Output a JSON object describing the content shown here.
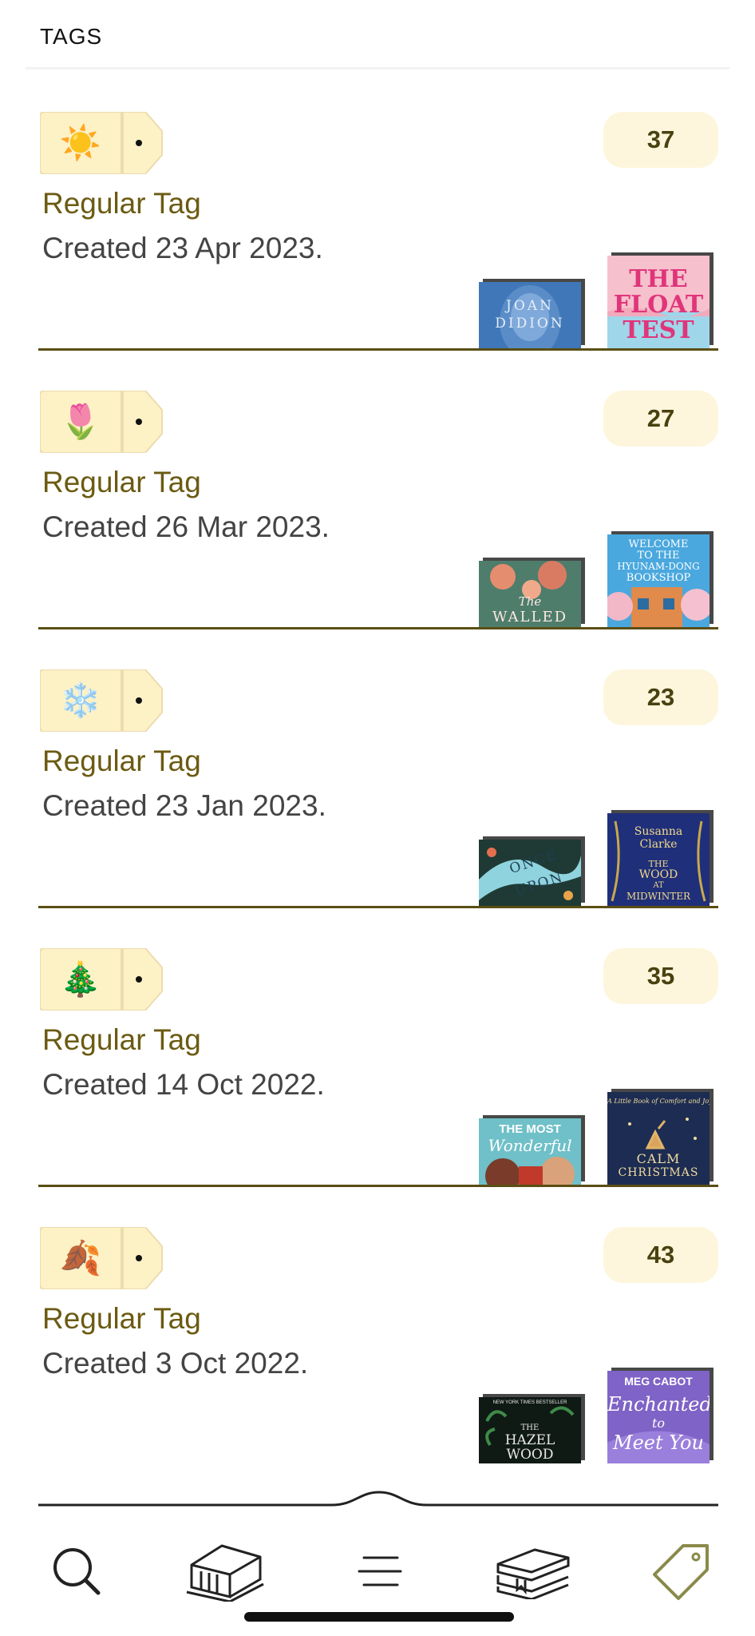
{
  "header": {
    "title": "TAGS"
  },
  "tags": [
    {
      "emoji": "☀️",
      "count": "37",
      "type": "Regular Tag",
      "created": "Created 23 Apr 2023.",
      "book_left": {
        "lines": [
          "JOAN",
          "DIDION"
        ],
        "bg": "#3f77b8",
        "fg": "#e6eef8"
      },
      "book_right": {
        "lines": [
          "THE",
          "FLOAT",
          "TEST"
        ],
        "bg": "#f6c0cc",
        "fg": "#e0357a"
      }
    },
    {
      "emoji": "🌷",
      "count": "27",
      "type": "Regular Tag",
      "created": "Created 26 Mar 2023.",
      "book_left": {
        "lines": [
          "The",
          "WALLED"
        ],
        "bg": "#5e8c7a",
        "fg": "#fbe9e0"
      },
      "book_right": {
        "lines": [
          "WELCOME",
          "TO THE",
          "HYUNAM-DONG",
          "BOOKSHOP"
        ],
        "bg": "#4aa8de",
        "fg": "#ffffff"
      }
    },
    {
      "emoji": "❄️",
      "count": "23",
      "type": "Regular Tag",
      "created": "Created 23 Jan 2023.",
      "book_left": {
        "lines": [
          "ONCE",
          "UPON"
        ],
        "bg": "#1f3a34",
        "fg": "#1e3f52"
      },
      "book_right": {
        "lines": [
          "Susanna",
          "Clarke",
          "THE",
          "WOOD",
          "AT",
          "MIDWINTER"
        ],
        "bg": "#1f2f7a",
        "fg": "#f1d98a"
      }
    },
    {
      "emoji": "🎄",
      "count": "35",
      "type": "Regular Tag",
      "created": "Created 14 Oct 2022.",
      "book_left": {
        "lines": [
          "THE MOST",
          "Wonderful"
        ],
        "bg": "#6fc0c8",
        "fg": "#ffffff"
      },
      "book_right": {
        "lines": [
          "A Little Book of Comfort and Joy",
          "CALM",
          "CHRISTMAS"
        ],
        "bg": "#1d2c52",
        "fg": "#f0dca0"
      }
    },
    {
      "emoji": "🍂",
      "count": "43",
      "type": "Regular Tag",
      "created": "Created 3 Oct 2022.",
      "book_left": {
        "lines": [
          "NEW YORK TIMES BESTSELLER",
          "THE",
          "HAZEL",
          "WOOD"
        ],
        "bg": "#0f1a14",
        "fg": "#e8e8e8"
      },
      "book_right": {
        "lines": [
          "MEG CABOT",
          "Enchanted",
          "to",
          "Meet You"
        ],
        "bg": "#7f63c6",
        "fg": "#ffffff"
      }
    }
  ],
  "tab_bar": {
    "items": [
      {
        "icon": "search-icon"
      },
      {
        "icon": "bookshelf-icon"
      },
      {
        "icon": "menu-icon"
      },
      {
        "icon": "books-stack-icon"
      },
      {
        "icon": "tag-icon",
        "selected": true
      }
    ],
    "accent": "#8a8a4a"
  }
}
